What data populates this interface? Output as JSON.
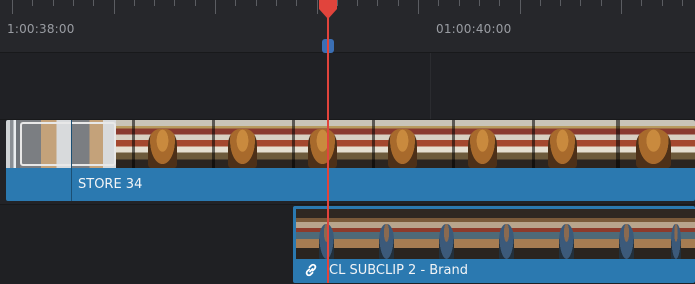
{
  "ruler": {
    "timecode_left": "1:00:38:00",
    "timecode_right": "01:00:40:00"
  },
  "tracks": {
    "v2_clip": {
      "name": "STORE 34"
    },
    "v1_clip": {
      "name": "CL SUBCLIP 2 - Brand",
      "linked_icon": "link-icon"
    }
  },
  "colors": {
    "clip_fill": "#2b79b0",
    "playhead": "#e1443c",
    "marker": "#3b6fb4",
    "background": "#1f2023"
  }
}
